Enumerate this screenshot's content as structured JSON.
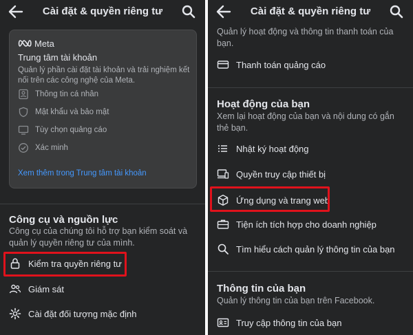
{
  "left": {
    "header_title": "Cài đặt & quyền riêng tư",
    "account_center": {
      "brand": "Meta",
      "title": "Trung tâm tài khoản",
      "description": "Quản lý phần cài đặt tài khoản và trải nghiệm kết nối trên các công nghệ của Meta.",
      "items": [
        {
          "label": "Thông tin cá nhân",
          "icon": "person-card-icon"
        },
        {
          "label": "Mật khẩu và bảo mật",
          "icon": "shield-icon"
        },
        {
          "label": "Tùy chọn quảng cáo",
          "icon": "monitor-icon"
        },
        {
          "label": "Xác minh",
          "icon": "verified-check-icon"
        }
      ],
      "link": "Xem thêm trong Trung tâm tài khoản"
    },
    "tools": {
      "title": "Công cụ và nguồn lực",
      "description": "Công cụ của chúng tôi hỗ trợ bạn kiểm soát và quản lý quyền riêng tư của mình.",
      "items": [
        {
          "label": "Kiểm tra quyền riêng tư",
          "icon": "lock-icon",
          "highlighted": true
        },
        {
          "label": "Giám sát",
          "icon": "people-icon"
        },
        {
          "label": "Cài đặt đối tượng mặc định",
          "icon": "gear-icon"
        }
      ]
    }
  },
  "right": {
    "header_title": "Cài đặt & quyền riêng tư",
    "top_desc": "Quản lý hoạt động và thông tin thanh toán của bạn.",
    "payment_item": {
      "label": "Thanh toán quảng cáo",
      "icon": "credit-card-icon"
    },
    "activity": {
      "title": "Hoạt động của bạn",
      "description": "Xem lại hoạt động của bạn và nội dung có gắn thẻ bạn.",
      "items": [
        {
          "label": "Nhật ký hoạt động",
          "icon": "list-icon"
        },
        {
          "label": "Quyền truy cập thiết bị",
          "icon": "device-icon"
        },
        {
          "label": "Ứng dụng và trang web",
          "icon": "cube-icon",
          "highlighted": true
        },
        {
          "label": "Tiện ích tích hợp cho doanh nghiệp",
          "icon": "briefcase-icon"
        },
        {
          "label": "Tìm hiểu cách quản lý thông tin của bạn",
          "icon": "search-icon"
        }
      ]
    },
    "your_info": {
      "title": "Thông tin của bạn",
      "description": "Quản lý thông tin của bạn trên Facebook.",
      "items": [
        {
          "label": "Truy cập thông tin của bạn",
          "icon": "id-card-icon"
        }
      ]
    }
  },
  "colors": {
    "background": "#242526",
    "card": "#3a3b3c",
    "link": "#4599ff",
    "highlight": "#e0121c"
  }
}
